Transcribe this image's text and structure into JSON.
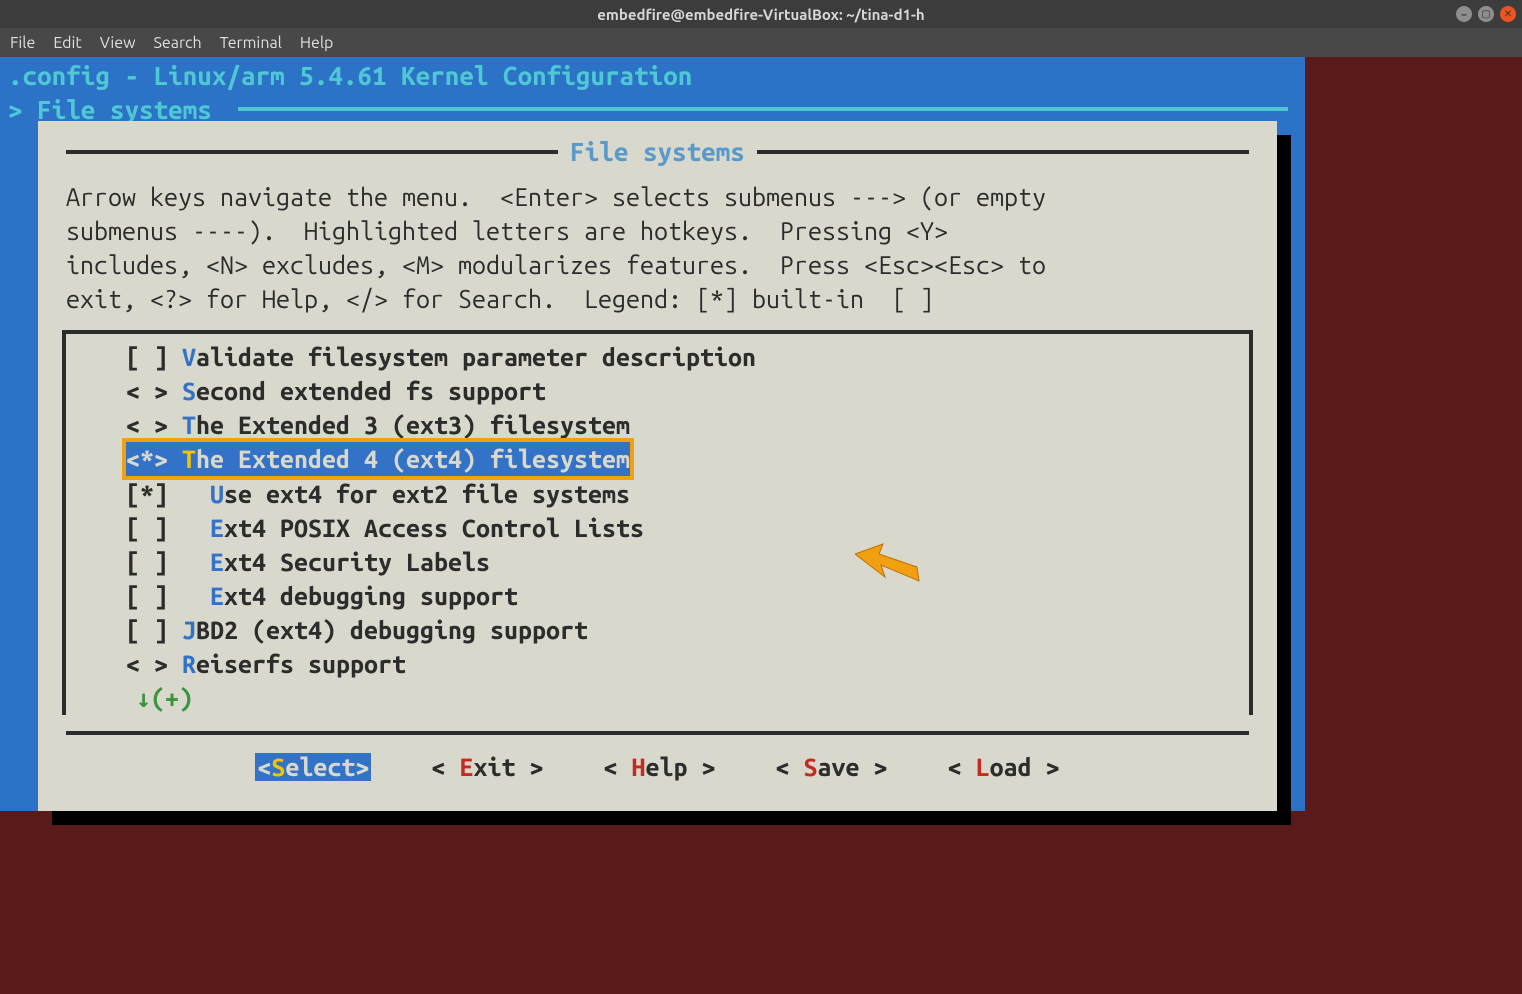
{
  "window": {
    "title": "embedfire@embedfire-VirtualBox: ~/tina-d1-h"
  },
  "menubar": [
    "File",
    "Edit",
    "View",
    "Search",
    "Terminal",
    "Help"
  ],
  "config_header": ".config - Linux/arm 5.4.61 Kernel Configuration",
  "breadcrumb": "> File systems",
  "dialog_title": "File systems",
  "help_text": "Arrow keys navigate the menu.  <Enter> selects submenus ---> (or empty\nsubmenus ----).  Highlighted letters are hotkeys.  Pressing <Y>\nincludes, <N> excludes, <M> modularizes features.  Press <Esc><Esc> to\nexit, <?> for Help, </> for Search.  Legend: [*] built-in  [ ]",
  "items": [
    {
      "prefix": "[ ] ",
      "hotkey": "V",
      "rest": "alidate filesystem parameter description",
      "selected": false,
      "indent": ""
    },
    {
      "prefix": "< > ",
      "hotkey": "S",
      "rest": "econd extended fs support",
      "selected": false,
      "indent": ""
    },
    {
      "prefix": "< > ",
      "hotkey": "T",
      "rest": "he Extended 3 (ext3) filesystem",
      "selected": false,
      "indent": ""
    },
    {
      "prefix": "<*> ",
      "hotkey": "T",
      "rest": "he Extended 4 (ext4) filesystem",
      "selected": true,
      "indent": ""
    },
    {
      "prefix": "[*]   ",
      "hotkey": "U",
      "rest": "se ext4 for ext2 file systems",
      "selected": false,
      "indent": ""
    },
    {
      "prefix": "[ ]   ",
      "hotkey": "E",
      "rest": "xt4 POSIX Access Control Lists",
      "selected": false,
      "indent": ""
    },
    {
      "prefix": "[ ]   ",
      "hotkey": "E",
      "rest": "xt4 Security Labels",
      "selected": false,
      "indent": ""
    },
    {
      "prefix": "[ ]   ",
      "hotkey": "E",
      "rest": "xt4 debugging support",
      "selected": false,
      "indent": ""
    },
    {
      "prefix": "[ ] ",
      "hotkey": "J",
      "rest": "BD2 (ext4) debugging support",
      "selected": false,
      "indent": ""
    },
    {
      "prefix": "< > ",
      "hotkey": "R",
      "rest": "eiserfs support",
      "selected": false,
      "indent": ""
    }
  ],
  "more_indicator": "↓(+)",
  "buttons": [
    {
      "pre": "<",
      "hotkey": "S",
      "rest": "elect>",
      "selected": true
    },
    {
      "pre": "< ",
      "hotkey": "E",
      "rest": "xit >",
      "selected": false
    },
    {
      "pre": "< ",
      "hotkey": "H",
      "rest": "elp >",
      "selected": false
    },
    {
      "pre": "< ",
      "hotkey": "S",
      "rest": "ave >",
      "selected": false
    },
    {
      "pre": "< ",
      "hotkey": "L",
      "rest": "oad >",
      "selected": false
    }
  ]
}
